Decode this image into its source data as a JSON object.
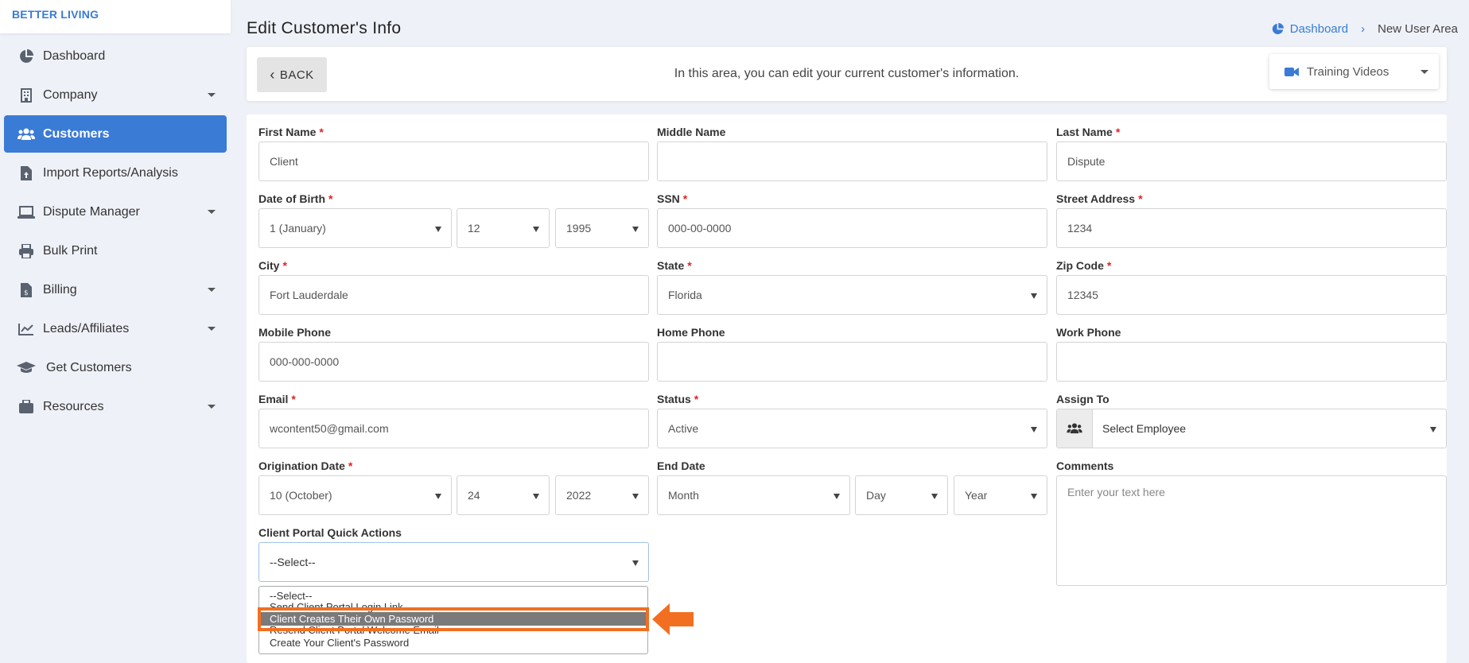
{
  "brand": "BETTER LIVING",
  "sidebar": {
    "items": [
      {
        "label": "Dashboard",
        "icon": "pie-chart-icon",
        "has_caret": false
      },
      {
        "label": "Company",
        "icon": "building-icon",
        "has_caret": true
      },
      {
        "label": "Customers",
        "icon": "users-icon",
        "has_caret": false,
        "active": true
      },
      {
        "label": "Import Reports/Analysis",
        "icon": "file-upload-icon",
        "has_caret": false
      },
      {
        "label": "Dispute Manager",
        "icon": "laptop-icon",
        "has_caret": true
      },
      {
        "label": "Bulk Print",
        "icon": "printer-icon",
        "has_caret": false
      },
      {
        "label": "Billing",
        "icon": "invoice-icon",
        "has_caret": true
      },
      {
        "label": "Leads/Affiliates",
        "icon": "chart-line-icon",
        "has_caret": true
      },
      {
        "label": "Get Customers",
        "icon": "graduation-cap-icon",
        "has_caret": false
      },
      {
        "label": "Resources",
        "icon": "briefcase-icon",
        "has_caret": true
      }
    ]
  },
  "header": {
    "title": "Edit Customer's Info",
    "breadcrumb": {
      "home": "Dashboard",
      "current": "New User Area"
    }
  },
  "topbar": {
    "back_label": "BACK",
    "message": "In this area, you can edit your current customer's information.",
    "training_label": "Training Videos"
  },
  "form": {
    "first_name": {
      "label": "First Name",
      "value": "Client"
    },
    "middle_name": {
      "label": "Middle Name",
      "value": ""
    },
    "last_name": {
      "label": "Last Name",
      "value": "Dispute"
    },
    "dob": {
      "label": "Date of Birth",
      "month": "1 (January)",
      "day": "12",
      "year": "1995"
    },
    "ssn": {
      "label": "SSN",
      "value": "000-00-0000"
    },
    "street": {
      "label": "Street Address",
      "value": "1234"
    },
    "city": {
      "label": "City",
      "value": "Fort Lauderdale"
    },
    "state": {
      "label": "State",
      "value": "Florida"
    },
    "zip": {
      "label": "Zip Code",
      "value": "12345"
    },
    "mobile": {
      "label": "Mobile Phone",
      "value": "000-000-0000"
    },
    "home_phone": {
      "label": "Home Phone",
      "value": ""
    },
    "work_phone": {
      "label": "Work Phone",
      "value": ""
    },
    "email": {
      "label": "Email",
      "value": "wcontent50@gmail.com"
    },
    "status": {
      "label": "Status",
      "value": "Active"
    },
    "assign_to": {
      "label": "Assign To",
      "value": "Select Employee"
    },
    "origination": {
      "label": "Origination Date",
      "month": "10 (October)",
      "day": "24",
      "year": "2022"
    },
    "end_date": {
      "label": "End Date",
      "month": "Month",
      "day": "Day",
      "year": "Year"
    },
    "comments": {
      "label": "Comments",
      "placeholder": "Enter your text here"
    },
    "quick_actions": {
      "label": "Client Portal Quick Actions",
      "value": "--Select--",
      "options": [
        "--Select--",
        "Send Client Portal Login Link",
        "Client Creates Their Own Password",
        "Resend Client Portal Welcome Email",
        "Create Your Client's Password"
      ],
      "highlighted_index": 2
    }
  },
  "colors": {
    "accent": "#3a7bd5",
    "required": "#e02424",
    "highlight_box": "#f26f21",
    "option_highlight": "#7a7a7a"
  }
}
